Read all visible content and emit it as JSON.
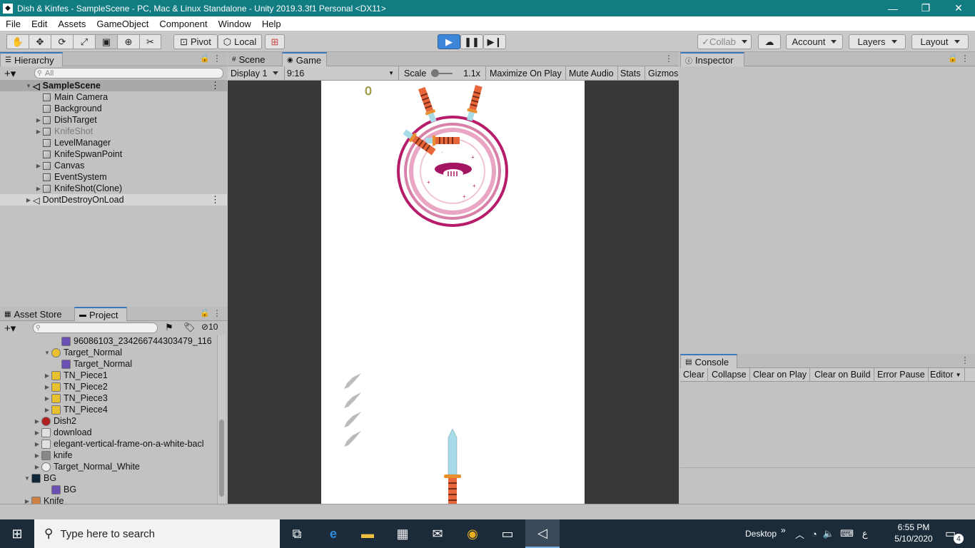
{
  "window": {
    "title": "Dish & Kinfes - SampleScene - PC, Mac & Linux Standalone - Unity 2019.3.3f1 Personal <DX11>"
  },
  "menu": [
    "File",
    "Edit",
    "Assets",
    "GameObject",
    "Component",
    "Window",
    "Help"
  ],
  "toolbar": {
    "pivot": "Pivot",
    "local": "Local",
    "collab": "Collab",
    "account": "Account",
    "layers": "Layers",
    "layout": "Layout"
  },
  "hierarchy": {
    "tab": "Hierarchy",
    "search_placeholder": "All",
    "scene": "SampleScene",
    "items": [
      {
        "label": "Main Camera",
        "expand": false
      },
      {
        "label": "Background",
        "expand": false
      },
      {
        "label": "DishTarget",
        "expand": true
      },
      {
        "label": "KnifeShot",
        "expand": true,
        "dim": true
      },
      {
        "label": "LevelManager",
        "expand": false
      },
      {
        "label": "KnifeSpwanPoint",
        "expand": false
      },
      {
        "label": "Canvas",
        "expand": true
      },
      {
        "label": "EventSystem",
        "expand": false
      },
      {
        "label": "KnifeShot(Clone)",
        "expand": true
      }
    ],
    "dontdestroy": "DontDestroyOnLoad"
  },
  "project": {
    "tabs": [
      "Asset Store",
      "Project"
    ],
    "count": "10",
    "items": [
      {
        "label": "96086103_234266744303479_116",
        "indent": 2
      },
      {
        "label": "Target_Normal",
        "indent": 1
      },
      {
        "label": "Target_Normal",
        "indent": 2
      },
      {
        "label": "TN_Piece1",
        "indent": 1
      },
      {
        "label": "TN_Piece2",
        "indent": 1
      },
      {
        "label": "TN_Piece3",
        "indent": 1
      },
      {
        "label": "TN_Piece4",
        "indent": 1
      },
      {
        "label": "Dish2",
        "indent": 0
      },
      {
        "label": "download",
        "indent": 0
      },
      {
        "label": "elegant-vertical-frame-on-a-white-bacl",
        "indent": 0
      },
      {
        "label": "knife",
        "indent": 0
      },
      {
        "label": "Target_Normal_White",
        "indent": 0
      },
      {
        "label": "BG",
        "indent": -1
      },
      {
        "label": "BG",
        "indent": 1
      },
      {
        "label": "Knife",
        "indent": -1
      }
    ]
  },
  "scene_tabs": [
    "Scene",
    "Game"
  ],
  "game_toolbar": {
    "display": "Display 1",
    "aspect": "9:16",
    "scale_label": "Scale",
    "scale_value": "1.1x",
    "maximize": "Maximize On Play",
    "mute": "Mute Audio",
    "stats": "Stats",
    "gizmos": "Gizmos"
  },
  "game": {
    "score": "0",
    "knives_remaining": 4
  },
  "inspector": {
    "tab": "Inspector"
  },
  "console": {
    "tab": "Console",
    "buttons": [
      "Clear",
      "Collapse",
      "Clear on Play",
      "Clear on Build",
      "Error Pause",
      "Editor"
    ]
  },
  "taskbar": {
    "search_placeholder": "Type here to search",
    "desktop": "Desktop",
    "time": "6:55 PM",
    "date": "5/10/2020",
    "lang": "ع",
    "notifications": "4"
  }
}
